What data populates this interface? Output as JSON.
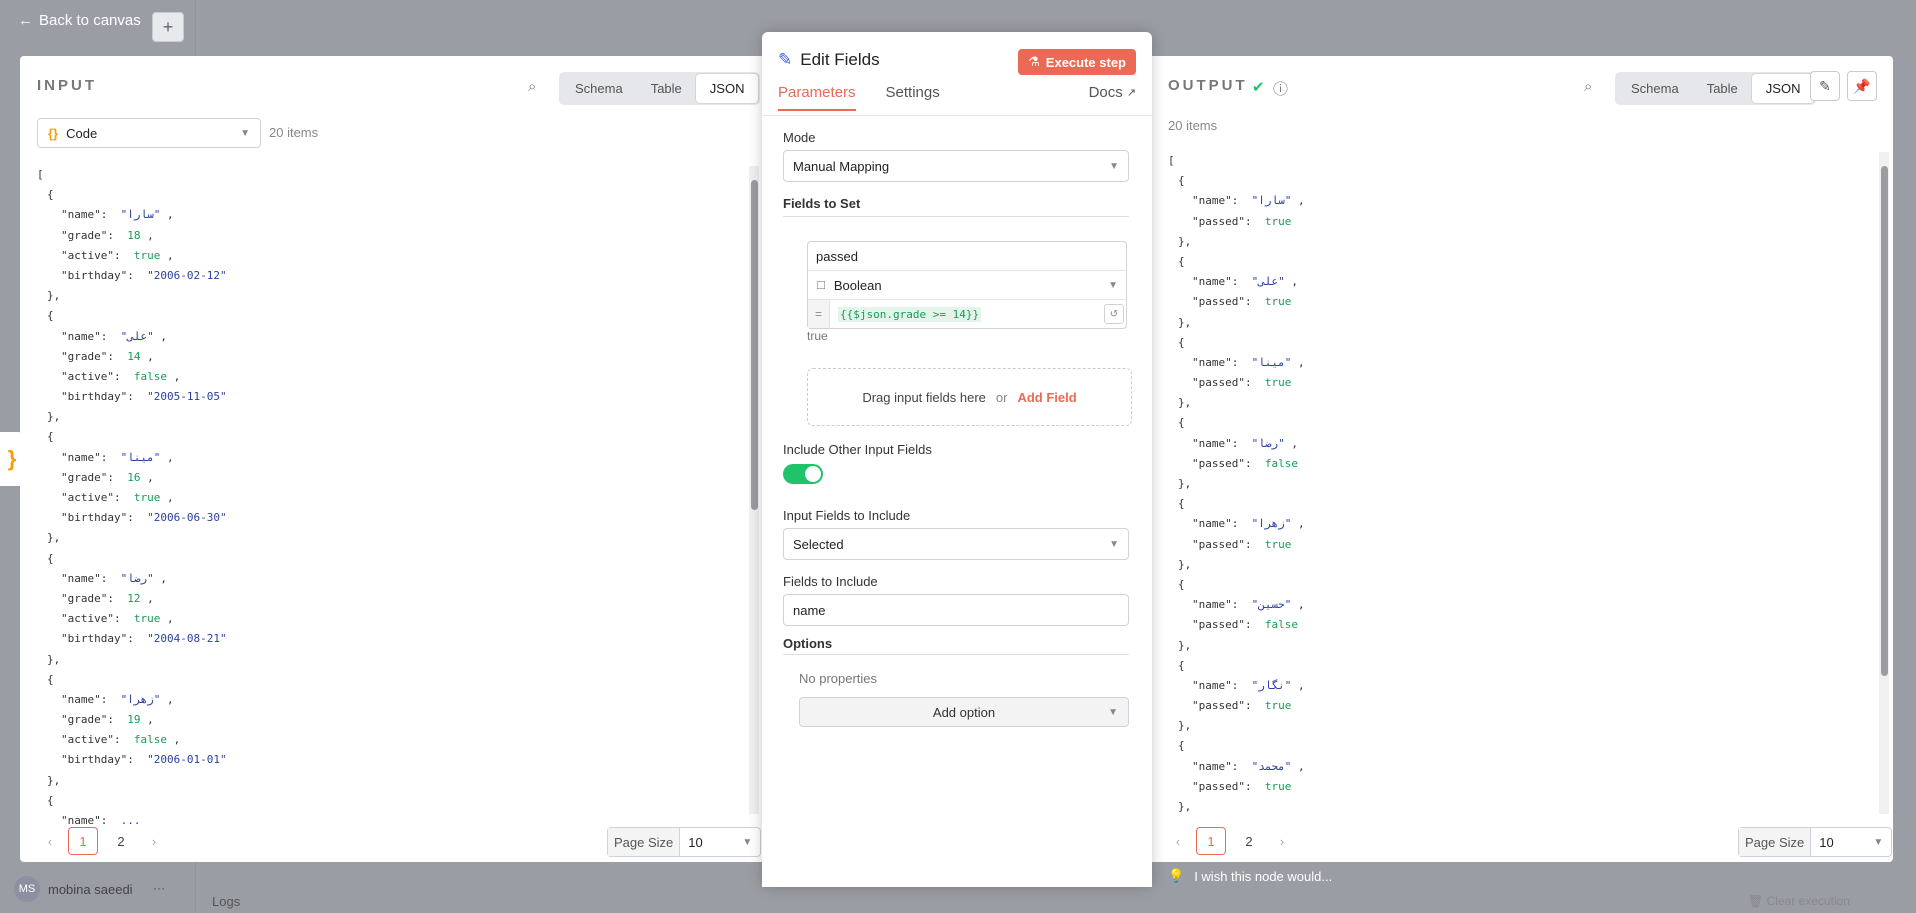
{
  "background": {
    "back_label": "Back to canvas",
    "user_initials": "MS",
    "user_name": "mobina saeedi",
    "logs_label": "Logs",
    "clear_execution": "Clear execution",
    "feedback": "I wish this node would..."
  },
  "input": {
    "title": "INPUT",
    "views": [
      "Schema",
      "Table",
      "JSON"
    ],
    "active_view": "JSON",
    "source_select": "Code",
    "items_count": "20 items",
    "records": [
      {
        "name": "سارا",
        "grade": "18",
        "active": "true",
        "birthday": "2006-02-12"
      },
      {
        "name": "علی",
        "grade": "14",
        "active": "false",
        "birthday": "2005-11-05"
      },
      {
        "name": "مینا",
        "grade": "16",
        "active": "true",
        "birthday": "2006-06-30"
      },
      {
        "name": "رضا",
        "grade": "12",
        "active": "true",
        "birthday": "2004-08-21"
      },
      {
        "name": "زهرا",
        "grade": "19",
        "active": "false",
        "birthday": "2006-01-01"
      }
    ],
    "partial_name": "...",
    "pages": [
      "1",
      "2"
    ],
    "page_size_label": "Page Size",
    "page_size": "10"
  },
  "editor": {
    "title": "Edit Fields",
    "execute_label": "Execute step",
    "tabs": [
      "Parameters",
      "Settings"
    ],
    "docs_label": "Docs",
    "mode_label": "Mode",
    "mode_value": "Manual Mapping",
    "fields_to_set_label": "Fields to Set",
    "field": {
      "name": "passed",
      "type": "Boolean",
      "expression": "{{$json.grade >= 14}}",
      "result": "true"
    },
    "drop_hint": "Drag input fields here",
    "or_label": "or",
    "add_field_label": "Add Field",
    "include_other_label": "Include Other Input Fields",
    "include_other_on": true,
    "input_fields_to_include_label": "Input Fields to Include",
    "input_fields_to_include_value": "Selected",
    "fields_to_include_label": "Fields to Include",
    "fields_to_include_value": "name",
    "options_label": "Options",
    "no_properties": "No properties",
    "add_option_label": "Add option"
  },
  "output": {
    "title": "OUTPUT",
    "views": [
      "Schema",
      "Table",
      "JSON"
    ],
    "active_view": "JSON",
    "items_count": "20 items",
    "records": [
      {
        "name": "سارا",
        "passed": "true"
      },
      {
        "name": "علی",
        "passed": "true"
      },
      {
        "name": "مینا",
        "passed": "true"
      },
      {
        "name": "رضا",
        "passed": "false"
      },
      {
        "name": "زهرا",
        "passed": "true"
      },
      {
        "name": "حسین",
        "passed": "false"
      },
      {
        "name": "نگار",
        "passed": "true"
      },
      {
        "name": "محمد",
        "passed": "true"
      }
    ],
    "pages": [
      "1",
      "2"
    ],
    "page_size_label": "Page Size",
    "page_size": "10"
  },
  "colors": {
    "accent": "#ea6a55",
    "success": "#1fc46a",
    "link": "#3b5bdb"
  }
}
